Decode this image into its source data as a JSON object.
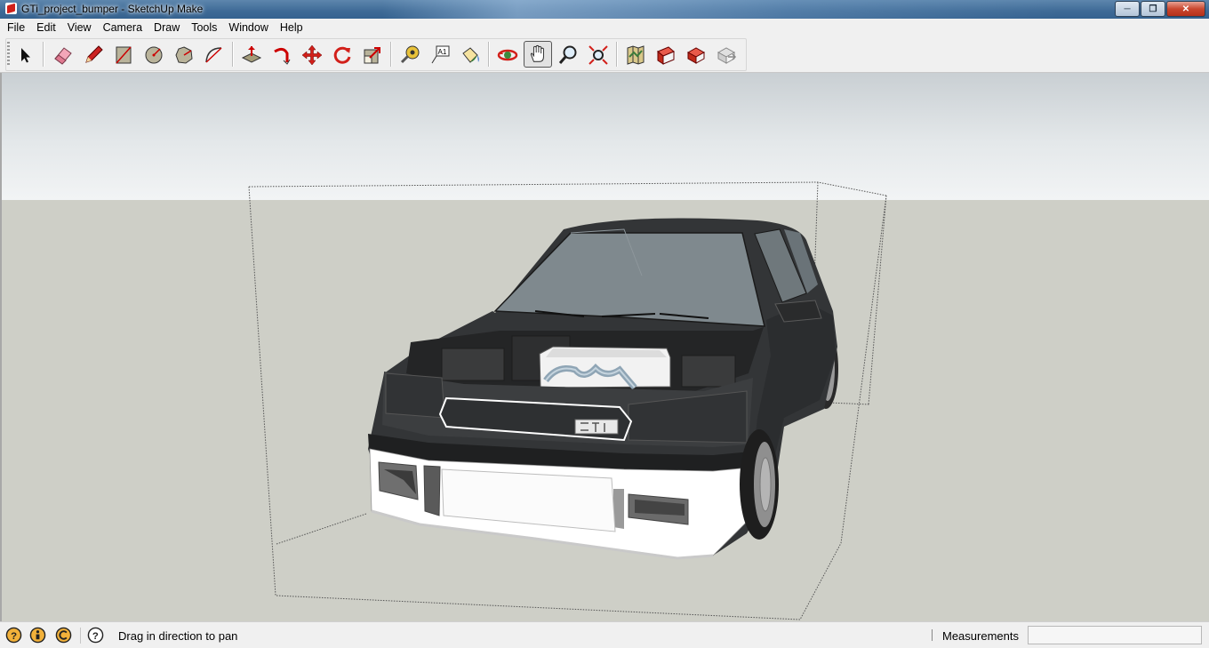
{
  "window": {
    "title": "GTi_project_bumper - SketchUp Make"
  },
  "menu": {
    "items": [
      {
        "label": "File"
      },
      {
        "label": "Edit"
      },
      {
        "label": "View"
      },
      {
        "label": "Camera"
      },
      {
        "label": "Draw"
      },
      {
        "label": "Tools"
      },
      {
        "label": "Window"
      },
      {
        "label": "Help"
      }
    ]
  },
  "toolbar": {
    "tools": [
      {
        "name": "select-tool",
        "icon": "arrow-icon"
      },
      {
        "name": "eraser-tool",
        "icon": "eraser-icon"
      },
      {
        "name": "pencil-tool",
        "icon": "pencil-icon"
      },
      {
        "name": "rectangle-tool",
        "icon": "rectangle-icon"
      },
      {
        "name": "circle-tool",
        "icon": "circle-icon"
      },
      {
        "name": "polygon-tool",
        "icon": "polygon-icon"
      },
      {
        "name": "arc-tool",
        "icon": "arc-icon"
      },
      {
        "name": "push-pull-tool",
        "icon": "push-pull-icon"
      },
      {
        "name": "follow-me-tool",
        "icon": "follow-me-icon"
      },
      {
        "name": "move-tool",
        "icon": "move-icon"
      },
      {
        "name": "rotate-tool",
        "icon": "rotate-icon"
      },
      {
        "name": "scale-tool",
        "icon": "scale-icon"
      },
      {
        "name": "tape-measure-tool",
        "icon": "tape-measure-icon"
      },
      {
        "name": "text-tool",
        "icon": "text-icon",
        "text": "A1"
      },
      {
        "name": "paint-bucket-tool",
        "icon": "paint-bucket-icon"
      },
      {
        "name": "orbit-tool",
        "icon": "orbit-icon"
      },
      {
        "name": "pan-tool",
        "icon": "hand-icon",
        "active": true
      },
      {
        "name": "zoom-tool",
        "icon": "magnifier-icon"
      },
      {
        "name": "zoom-extents-tool",
        "icon": "zoom-extents-icon"
      },
      {
        "name": "add-location-tool",
        "icon": "map-icon"
      },
      {
        "name": "warehouse-tool",
        "icon": "warehouse-icon"
      },
      {
        "name": "share-model-tool",
        "icon": "share-model-icon"
      },
      {
        "name": "extension-tool",
        "icon": "extension-icon"
      }
    ]
  },
  "status": {
    "icons": [
      "geo-location-icon",
      "credits-icon",
      "copyright-icon",
      "help-icon"
    ],
    "message": "Drag in direction to pan",
    "measurements_label": "Measurements",
    "measurements_value": ""
  },
  "colors": {
    "sky": "#e4e8ea",
    "ground": "#cecfc7",
    "car_body": "#2f3133",
    "bumper": "#ffffff",
    "accent_red": "#d0201a"
  }
}
